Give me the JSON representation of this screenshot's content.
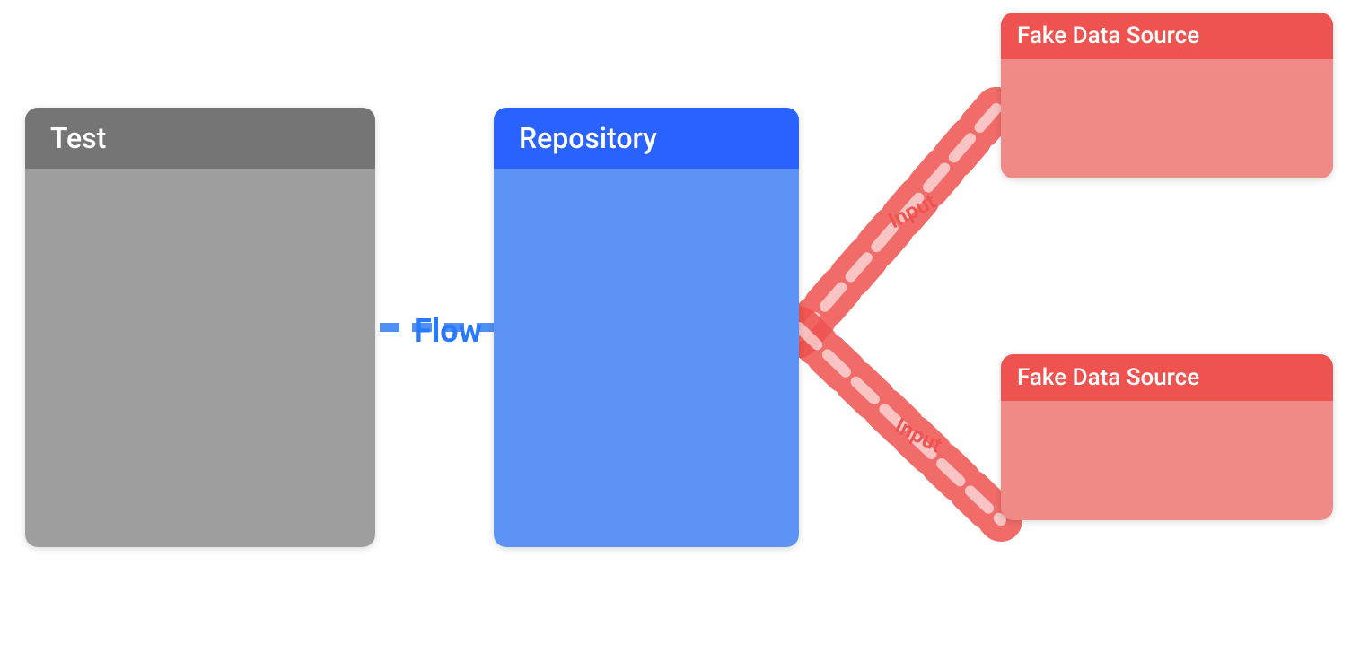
{
  "test_block": {
    "header": "Test",
    "bg_header": "#757575",
    "bg_body": "#9e9e9e"
  },
  "repo_block": {
    "header": "Repository",
    "bg_header": "#2962ff",
    "bg_body": "#5c93f5"
  },
  "fds_top": {
    "header": "Fake Data Source",
    "bg_header": "#ef5350",
    "bg_body": "#ef8a87"
  },
  "fds_bottom": {
    "header": "Fake Data Source",
    "bg_header": "#ef5350",
    "bg_body": "#ef8a87"
  },
  "flow_label": "Flow",
  "input_top": "Input",
  "input_bottom": "Input",
  "colors": {
    "flow_line": "#4e90f5",
    "input_line": "#ef5350",
    "arrow_fill": "rgba(255,255,255,0.85)",
    "dashed_white": "rgba(255,255,255,0.9)"
  }
}
